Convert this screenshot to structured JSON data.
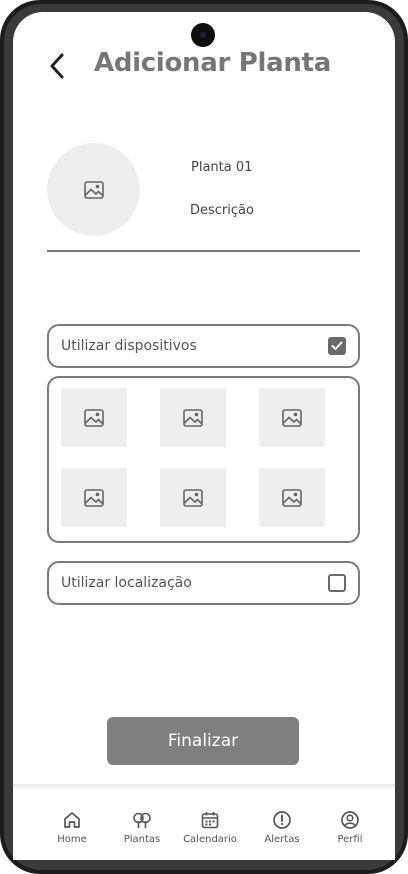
{
  "header": {
    "title": "Adicionar Planta",
    "back_icon": "chevron-left-icon"
  },
  "plant": {
    "name": "Planta 01",
    "description": "Descrição",
    "image_icon": "image-placeholder-icon"
  },
  "options": {
    "devices_label": "Utilizar dispositivos",
    "devices_checked": true,
    "location_label": "Utilizar localização",
    "location_checked": false
  },
  "device_tiles": [
    {
      "icon": "image-placeholder-icon"
    },
    {
      "icon": "image-placeholder-icon"
    },
    {
      "icon": "image-placeholder-icon"
    },
    {
      "icon": "image-placeholder-icon"
    },
    {
      "icon": "image-placeholder-icon"
    },
    {
      "icon": "image-placeholder-icon"
    }
  ],
  "actions": {
    "finish_label": "Finalizar"
  },
  "nav": {
    "items": [
      {
        "label": "Home",
        "icon": "home-icon"
      },
      {
        "label": "Plantas",
        "icon": "plants-icon"
      },
      {
        "label": "Calendario",
        "icon": "calendar-icon"
      },
      {
        "label": "Alertas",
        "icon": "alert-icon"
      },
      {
        "label": "Perfil",
        "icon": "profile-icon"
      }
    ]
  },
  "colors": {
    "title": "#767676",
    "button": "#7f7f7f",
    "placeholder_bg": "#eeeeee",
    "border": "#7a7a7a"
  }
}
